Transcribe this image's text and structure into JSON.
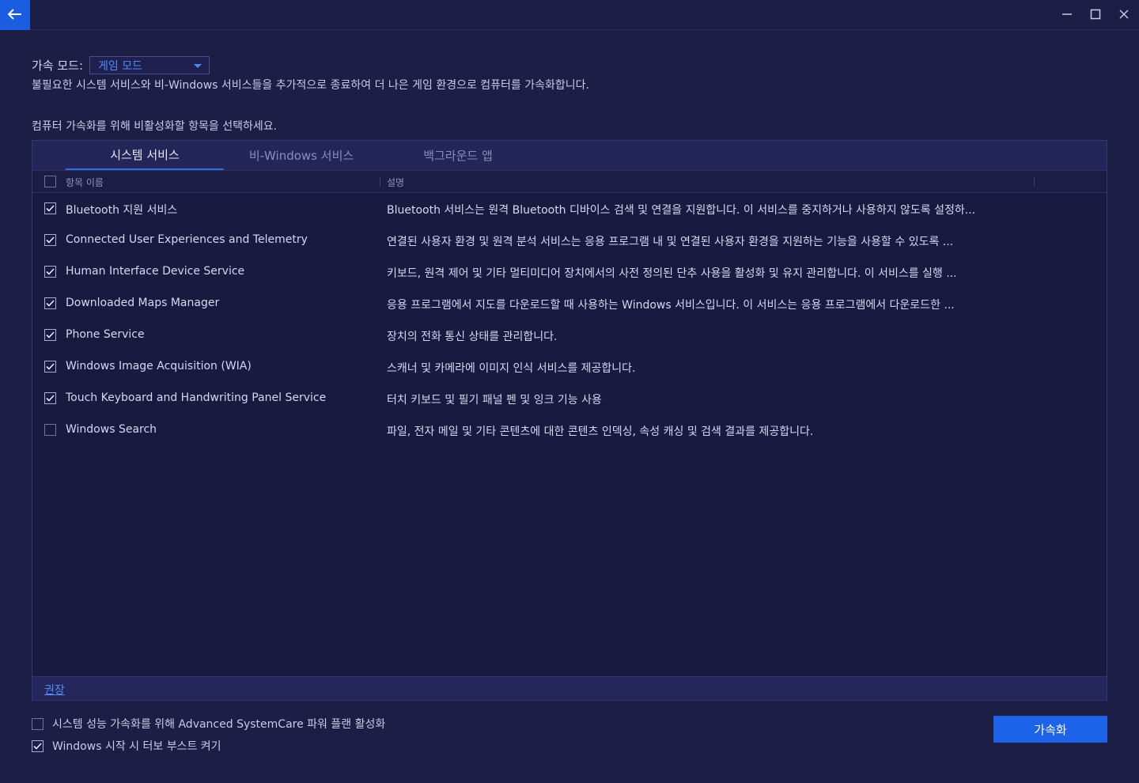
{
  "mode": {
    "label": "가속 모드:",
    "selected": "게임 모드",
    "description": "불필요한 시스템 서비스와 비-Windows 서비스들을 추가적으로 종료하여 더 나은 게임 환경으로 컴퓨터를 가속화합니다."
  },
  "select_prompt": "컴퓨터 가속화를 위해 비활성화할 항목을 선택하세요.",
  "tabs": [
    {
      "label": "시스템 서비스",
      "active": true
    },
    {
      "label": "비-Windows 서비스",
      "active": false
    },
    {
      "label": "백그라운드 앱",
      "active": false
    }
  ],
  "columns": {
    "name": "항목 이름",
    "description": "설명"
  },
  "items": [
    {
      "name": "Bluetooth 지원 서비스",
      "description": "Bluetooth 서비스는 원격 Bluetooth 디바이스 검색 및 연결을 지원합니다. 이 서비스를 중지하거나 사용하지 않도록 설정하...",
      "checked": true
    },
    {
      "name": "Connected User Experiences and Telemetry",
      "description": "연결된 사용자 환경 및 원격 분석 서비스는 응용 프로그램 내 및 연결된 사용자 환경을 지원하는 기능을 사용할 수 있도록 ...",
      "checked": true
    },
    {
      "name": "Human Interface Device Service",
      "description": "키보드, 원격 제어 및 기타 멀티미디어 장치에서의 사전 정의된 단추 사용을 활성화 및 유지 관리합니다. 이 서비스를 실행 ...",
      "checked": true
    },
    {
      "name": "Downloaded Maps Manager",
      "description": "응용 프로그램에서 지도를 다운로드할 때 사용하는 Windows 서비스입니다. 이 서비스는 응용 프로그램에서 다운로드한 ...",
      "checked": true
    },
    {
      "name": "Phone Service",
      "description": "장치의 전화 통신 상태를 관리합니다.",
      "checked": true
    },
    {
      "name": "Windows Image Acquisition (WIA)",
      "description": "스캐너 및 카메라에 이미지 인식 서비스를 제공합니다.",
      "checked": true
    },
    {
      "name": "Touch Keyboard and Handwriting Panel Service",
      "description": "터치 키보드 및 필기 패널 펜 및 잉크 기능 사용",
      "checked": true
    },
    {
      "name": "Windows Search",
      "description": "파일, 전자 메일 및 기타 콘텐츠에 대한 콘텐츠 인덱싱, 속성 캐싱 및 검색 결과를 제공합니다.",
      "checked": false
    }
  ],
  "recommend_link": "권장",
  "options": [
    {
      "label": "시스템 성능 가속화를 위해 Advanced SystemCare 파워 플랜 활성화",
      "checked": false
    },
    {
      "label": "Windows 시작 시 터보 부스트 켜기",
      "checked": true
    }
  ],
  "accelerate_button": "가속화",
  "colors": {
    "background": "#1d1e46",
    "accent": "#1d63e8",
    "link": "#4f8bf5"
  }
}
